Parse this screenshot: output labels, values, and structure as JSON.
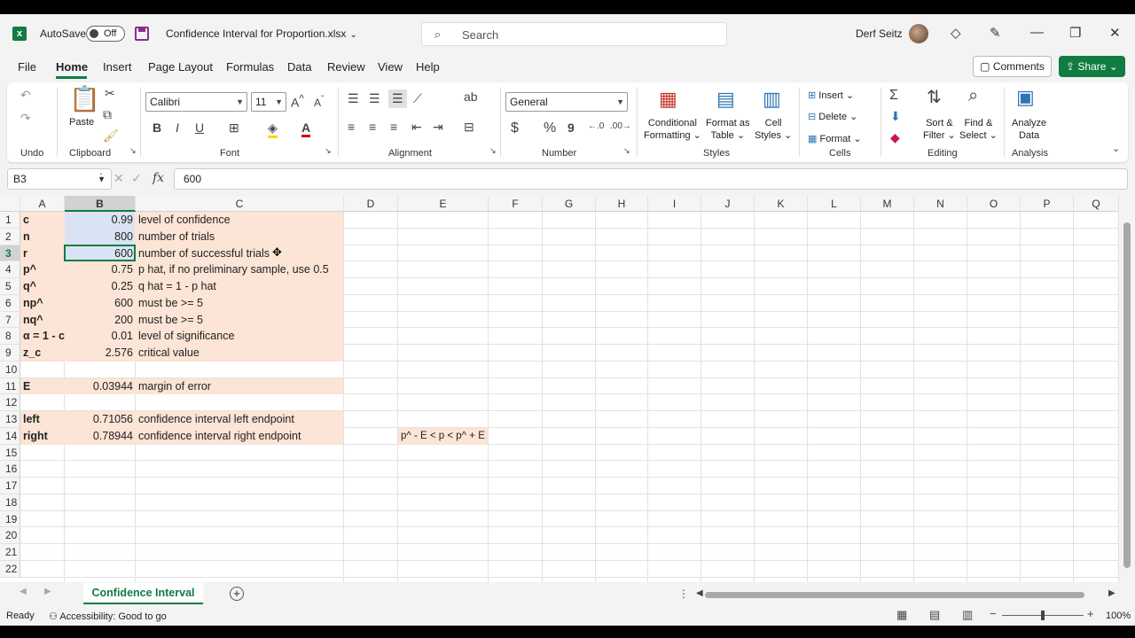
{
  "titlebar": {
    "app_icon": "excel-logo-icon",
    "autosave_label": "AutoSave",
    "autosave_state": "Off",
    "file_name": "Confidence Interval for Proportion.xlsx",
    "search_placeholder": "Search",
    "user_name": "Derf Seitz"
  },
  "menu": {
    "tabs": [
      "File",
      "Home",
      "Insert",
      "Page Layout",
      "Formulas",
      "Data",
      "Review",
      "View",
      "Help"
    ],
    "active": "Home",
    "comments_label": "Comments",
    "share_label": "Share"
  },
  "ribbon": {
    "groups": [
      "Undo",
      "Clipboard",
      "Font",
      "Alignment",
      "Number",
      "Styles",
      "Cells",
      "Editing",
      "Analysis"
    ],
    "paste_label": "Paste",
    "font_name": "Calibri",
    "font_size": "11",
    "number_format": "General",
    "bold": "B",
    "italic": "I",
    "underline": "U",
    "currency": "$",
    "percent": "%",
    "comma": "9",
    "cond_format_l1": "Conditional",
    "cond_format_l2": "Formatting",
    "format_table_l1": "Format as",
    "format_table_l2": "Table",
    "cell_styles_l1": "Cell",
    "cell_styles_l2": "Styles",
    "insert_label": "Insert",
    "delete_label": "Delete",
    "format_label": "Format",
    "sort_l1": "Sort &",
    "sort_l2": "Filter",
    "find_l1": "Find &",
    "find_l2": "Select",
    "analyze_l1": "Analyze",
    "analyze_l2": "Data"
  },
  "formula_bar": {
    "name_box": "B3",
    "fx": "fx",
    "content": "600"
  },
  "grid": {
    "columns": [
      "A",
      "B",
      "C",
      "D",
      "E",
      "F",
      "G",
      "H",
      "I",
      "J",
      "K",
      "L",
      "M",
      "N",
      "O",
      "P",
      "Q"
    ],
    "rows": [
      "1",
      "2",
      "3",
      "4",
      "5",
      "6",
      "7",
      "8",
      "9",
      "10",
      "11",
      "12",
      "13",
      "14",
      "15",
      "16",
      "17",
      "18",
      "19",
      "20",
      "21",
      "22"
    ],
    "selected_column": "B",
    "selected_row": "3",
    "colA": [
      "c",
      "n",
      "r",
      "p^",
      "q^",
      "np^",
      "nq^",
      "α = 1 - c",
      "z_c",
      "",
      "E",
      "",
      "left",
      "right"
    ],
    "colB": [
      "0.99",
      "800",
      "600",
      "0.75",
      "0.25",
      "600",
      "200",
      "0.01",
      "2.576",
      "",
      "0.03944",
      "",
      "0.71056",
      "0.78944"
    ],
    "colC": [
      "level of confidence",
      "number of trials",
      "number of successful trials",
      "p hat, if no preliminary sample, use 0.5",
      "q hat = 1 - p hat",
      "must be >= 5",
      "must be >= 5",
      "level of significance",
      "critical value",
      "",
      "margin of error",
      "",
      "confidence interval left endpoint",
      "confidence interval right endpoint"
    ],
    "E14": "p^ - E < p < p^ + E"
  },
  "sheets": {
    "active_tab": "Confidence Interval"
  },
  "status": {
    "ready": "Ready",
    "accessibility": "Accessibility: Good to go",
    "zoom": "100%"
  },
  "colors": {
    "accent": "#107c41",
    "cell_fill": "#fce4d6",
    "selection_fill": "#dae3f3"
  }
}
